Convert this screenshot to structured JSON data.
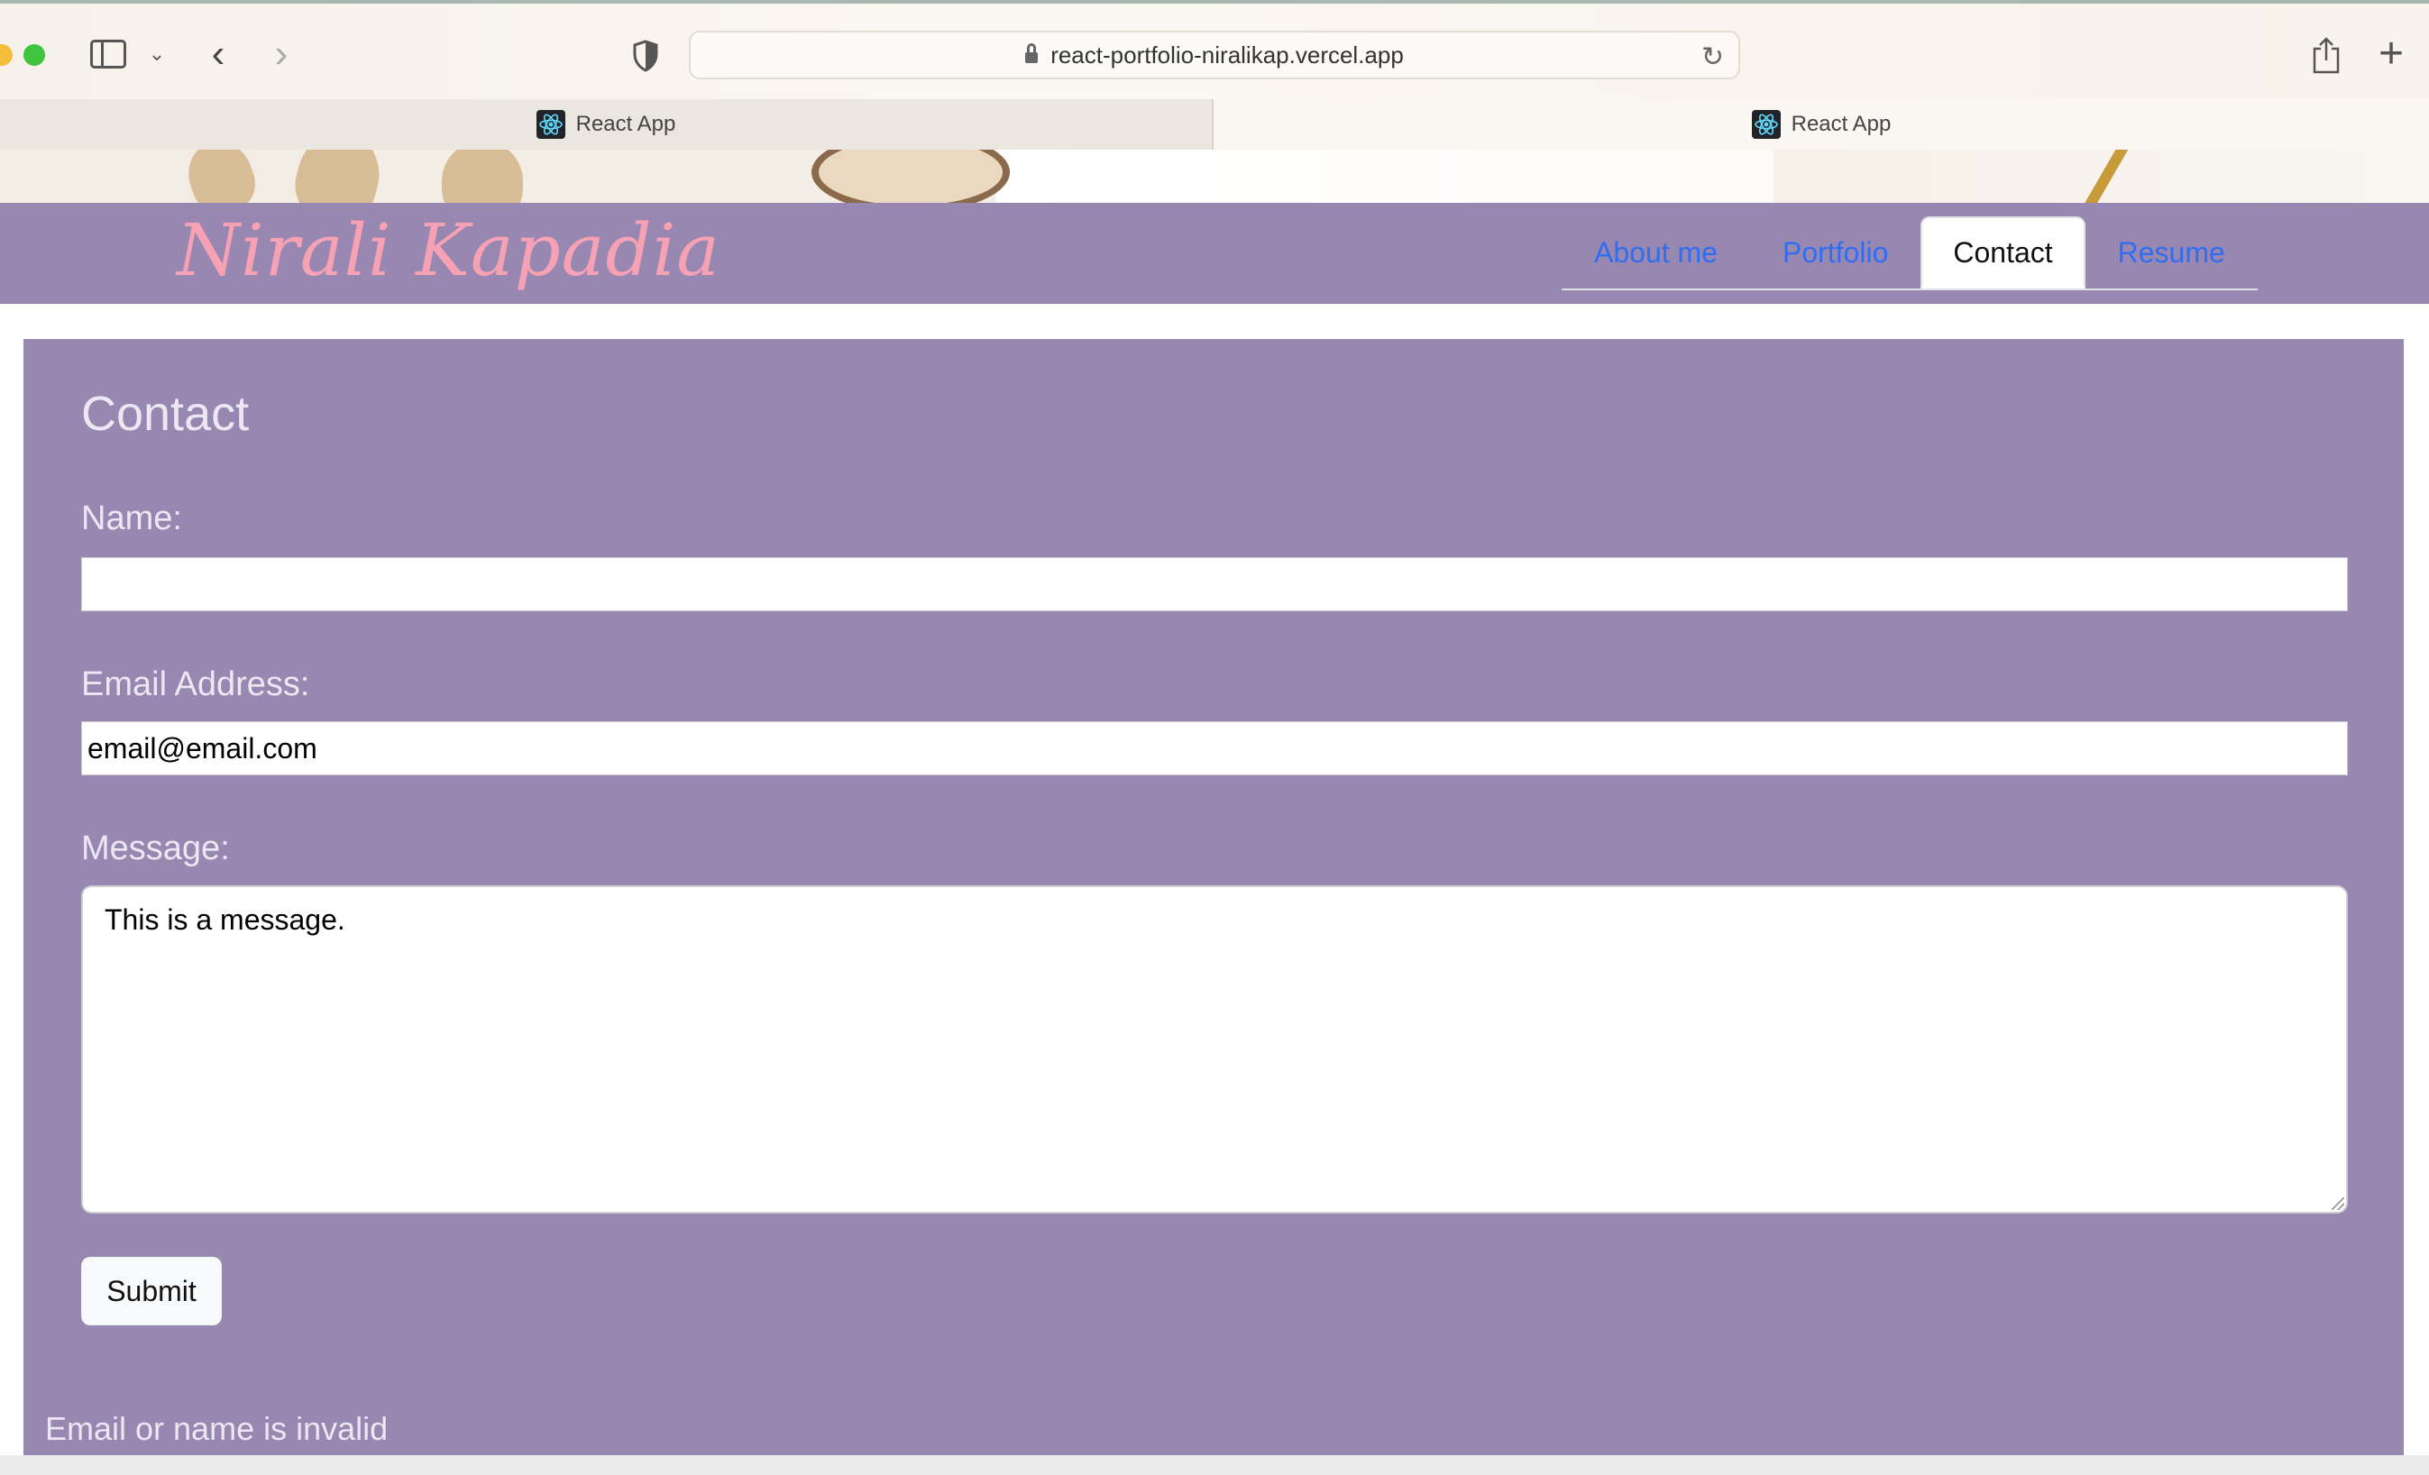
{
  "browser": {
    "url": "react-portfolio-niralikap.vercel.app",
    "tabs": [
      {
        "title": "React App",
        "active": false
      },
      {
        "title": "React App",
        "active": true
      }
    ],
    "icons": [
      "sidebar-icon",
      "chevron-down-icon",
      "back-icon",
      "forward-icon",
      "shield-icon",
      "lock-icon",
      "reload-icon",
      "share-icon",
      "plus-icon"
    ]
  },
  "header": {
    "brand": "Nirali Kapadia",
    "nav": [
      {
        "label": "About me",
        "active": false
      },
      {
        "label": "Portfolio",
        "active": false
      },
      {
        "label": "Contact",
        "active": true
      },
      {
        "label": "Resume",
        "active": false
      }
    ]
  },
  "contact": {
    "title": "Contact",
    "name_label": "Name:",
    "name_value": "",
    "email_label": "Email Address:",
    "email_value": "email@email.com",
    "message_label": "Message:",
    "message_value": "This is a message.",
    "submit_label": "Submit",
    "error": "Email or name is invalid"
  },
  "colors": {
    "panel": "#9787b1",
    "brand": "#f6a2b4",
    "link": "#2f6df2"
  }
}
